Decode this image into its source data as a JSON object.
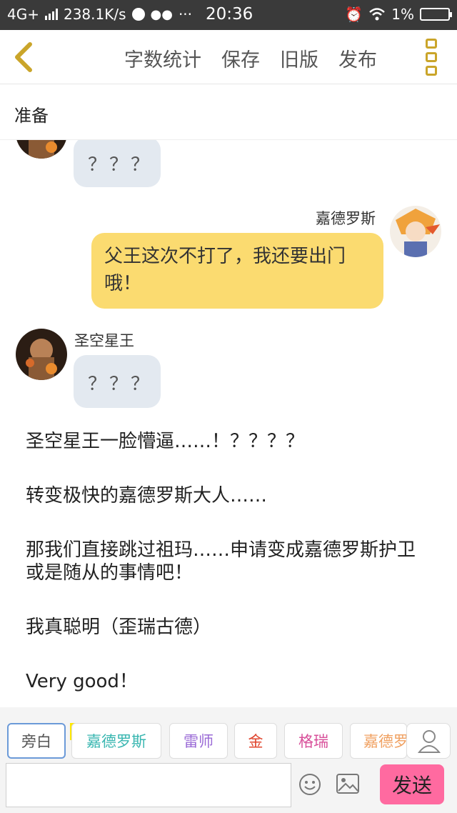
{
  "status_bar": {
    "network": "4G+",
    "speed": "238.1K/s",
    "more": "···",
    "time": "20:36",
    "battery": "1%"
  },
  "toolbar": {
    "word_count": "字数统计",
    "save": "保存",
    "old_version": "旧版",
    "publish": "发布"
  },
  "chapter_title": "准备",
  "messages": [
    {
      "speaker": "",
      "text": "？？？"
    },
    {
      "speaker": "嘉德罗斯",
      "text": "父王这次不打了，我还要出门哦！"
    },
    {
      "speaker": "圣空星王",
      "text": "？？？"
    }
  ],
  "narration": [
    "圣空星王一脸懵逼……！？？？？",
    "转变极快的嘉德罗斯大人……",
    "那我们直接跳过祖玛……申请变成嘉德罗斯护卫或是随从的事情吧！",
    "我真聪明（歪瑞古德）",
    "Very good！"
  ],
  "characters": {
    "narrator": "旁白",
    "main_badge": "主",
    "items": [
      {
        "label": "嘉德罗斯",
        "color": "#38b6b0"
      },
      {
        "label": "雷师",
        "color": "#9a6ad6"
      },
      {
        "label": "金",
        "color": "#e0452e"
      },
      {
        "label": "格瑞",
        "color": "#d8509a"
      },
      {
        "label": "嘉德罗",
        "color": "#f0a060"
      }
    ]
  },
  "send_label": "发送",
  "colors": {
    "accent": "#caa52a",
    "self_bubble": "#fbdb70",
    "other_bubble": "#e3e9f0",
    "send_button": "#ff6aa0"
  }
}
